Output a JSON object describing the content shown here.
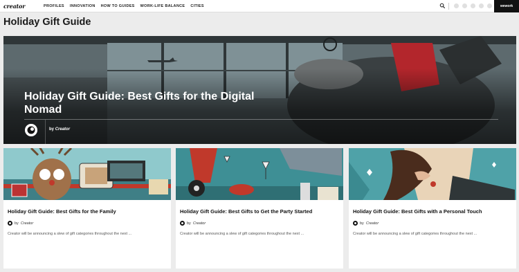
{
  "logo": "creator",
  "nav": {
    "items": [
      "PROFILES",
      "INNOVATION",
      "HOW TO GUIDES",
      "WORK-LIFE BALANCE",
      "CITIES"
    ]
  },
  "brand": "wework",
  "page_title": "Holiday Gift Guide",
  "hero": {
    "title": "Holiday Gift Guide: Best Gifts for the Digital Nomad",
    "by": "by",
    "author": "Creator"
  },
  "cards": [
    {
      "title": "Holiday Gift Guide: Best Gifts for the Family",
      "by": "by",
      "author": "Creator",
      "excerpt": "Creator will be announcing a slew of gift categories throughout the next ..."
    },
    {
      "title": "Holiday Gift Guide: Best Gifts to Get the Party Started",
      "by": "by",
      "author": "Creator",
      "excerpt": "Creator will be announcing a slew of gift categories throughout the next ..."
    },
    {
      "title": "Holiday Gift Guide: Best Gifts with a Personal Touch",
      "by": "by",
      "author": "Creator",
      "excerpt": "Creator will be announcing a slew of gift categories throughout the next ..."
    }
  ],
  "icons": {
    "search": "search-icon",
    "social": [
      "social-icon-1",
      "social-icon-2",
      "social-icon-3",
      "social-icon-4",
      "social-icon-5"
    ]
  },
  "colors": {
    "hero_bg": "#4c5457",
    "card_bg": "#ffffff",
    "page_bg": "#ececec",
    "teal": "#3e8f95",
    "red": "#c0392b"
  }
}
